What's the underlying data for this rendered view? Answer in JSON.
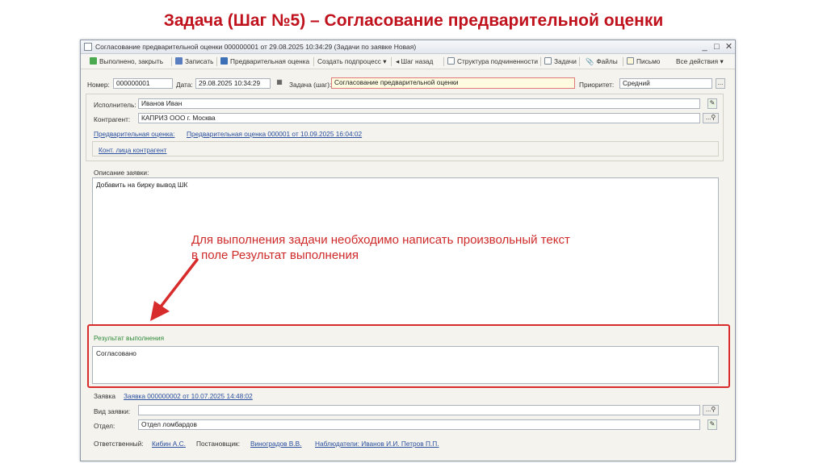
{
  "slide_title": "Задача (Шаг №5) – Согласование предварительной оценки",
  "window": {
    "title": "Согласование предварительной оценки 000000001 от 29.08.2025 10:34:29 (Задачи по заявке Новая)",
    "controls": {
      "minimize": "_",
      "maximize": "□",
      "close": "✕"
    }
  },
  "toolbar": {
    "done_close": "Выполнено, закрыть",
    "save": "Записать",
    "preliminary": "Предварительная оценка",
    "create_subprocess": "Создать подпроцесс ▾",
    "step_back": "◂ Шаг назад",
    "structure": "Структура подчиненности",
    "tasks": "Задачи",
    "files": "Файлы",
    "letter": "Письмо",
    "all_actions": "Все действия ▾"
  },
  "header_row": {
    "number_label": "Номер:",
    "number_value": "000000001",
    "date_label": "Дата:",
    "date_value": "29.08.2025 10:34:29",
    "task_label": "Задача (шаг):",
    "task_value": "Согласование предварительной оценки",
    "priority_label": "Приоритет:",
    "priority_value": "Средний"
  },
  "details": {
    "executor_label": "Исполнитель:",
    "executor_value": "Иванов Иван",
    "contractor_label": "Контрагент:",
    "contractor_value": "КАПРИЗ ООО г. Москва",
    "preliminary_label": "Предварительная оценка:",
    "preliminary_link": "Предварительная оценка 000001 от 10.09.2025 16:04:02",
    "contacts_link": "Конт. лица контрагент"
  },
  "description": {
    "label": "Описание заявки:",
    "text": "Добавить на бирку вывод ШК"
  },
  "annotation": {
    "line1": "Для выполнения задачи необходимо написать произвольный текст",
    "line2": "в поле Результат выполнения"
  },
  "result": {
    "label": "Результат выполнения",
    "text": "Согласовано"
  },
  "footer": {
    "request_label": "Заявка",
    "request_link": "Заявка 000000002 от 10.07.2025 14:48:02",
    "request_type_label": "Вид заявки:",
    "request_type_value": "",
    "dept_label": "Отдел:",
    "dept_value": "Отдел ломбардов",
    "responsible_label": "Ответственный:",
    "responsible_value": "Кибин А.С.",
    "setter_label": "Постановщик:",
    "setter_value": "Виноградов В.В.",
    "observers_value": "Наблюдатели: Иванов И.И. Петров П.П."
  },
  "colors": {
    "accent_red": "#d82b2b",
    "title_red": "#c0121d",
    "link_blue": "#2a4f9e",
    "label_green": "#2f8a3a"
  }
}
